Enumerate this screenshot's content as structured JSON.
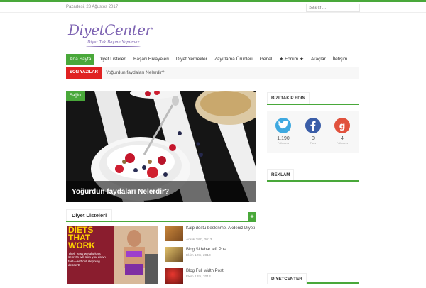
{
  "topbar": {
    "date": "Pazartesi, 28 Ağustos 2017",
    "search_placeholder": "Search..."
  },
  "brand": {
    "logo": "DiyetCenter",
    "tagline": "Diyet Tek Başına Yapılmaz",
    "accent": "#49a83a",
    "logo_color": "#7d63b2"
  },
  "nav": {
    "items": [
      {
        "label": "Ana Sayfa",
        "active": true
      },
      {
        "label": "Diyet Listeleri"
      },
      {
        "label": "Başarı Hikayeleri"
      },
      {
        "label": "Diyet Yemekler"
      },
      {
        "label": "Zayıflama Ürünleri"
      },
      {
        "label": "Genel"
      },
      {
        "label": "★ Forum ★"
      },
      {
        "label": "Araçlar"
      },
      {
        "label": "İletişim"
      }
    ]
  },
  "ticker": {
    "label": "SON YAZILAR",
    "headline": "Yoğurdun faydaları Nelerdir?",
    "label_color": "#e02222"
  },
  "featured": {
    "category": "Sağlık",
    "title": "Yoğurdun faydaları Nelerdir?"
  },
  "section": {
    "title": "Diyet Listeleri",
    "plus": "+"
  },
  "diet_image": {
    "lines": [
      "DIETS",
      "THAT",
      "WORK"
    ],
    "caption": "Their easy weight-loss secrets will slim you down fast—without skipping dessert!"
  },
  "posts": [
    {
      "title": "Kalp dostu beslenme. Akdeniz Diyeti",
      "date": "Aralık 28th, 2013"
    },
    {
      "title": "Blog Sidebar left Post",
      "date": "Ekim 12th, 2013"
    },
    {
      "title": "Blog Full width Post",
      "date": "Ekim 12th, 2013"
    }
  ],
  "sidebar": {
    "follow_title": "BIZI TAKIP EDIN",
    "social": [
      {
        "icon": "twitter-icon",
        "count": "1,190",
        "label": "Followers",
        "color": "#3fa9e0"
      },
      {
        "icon": "facebook-icon",
        "count": "0",
        "label": "Fans",
        "color": "#3b5ea8"
      },
      {
        "icon": "google-plus-icon",
        "count": "4",
        "label": "Followers",
        "color": "#e1523d"
      }
    ],
    "ads_title": "REKLAM",
    "bottom_title": "DIYETCENTER"
  }
}
